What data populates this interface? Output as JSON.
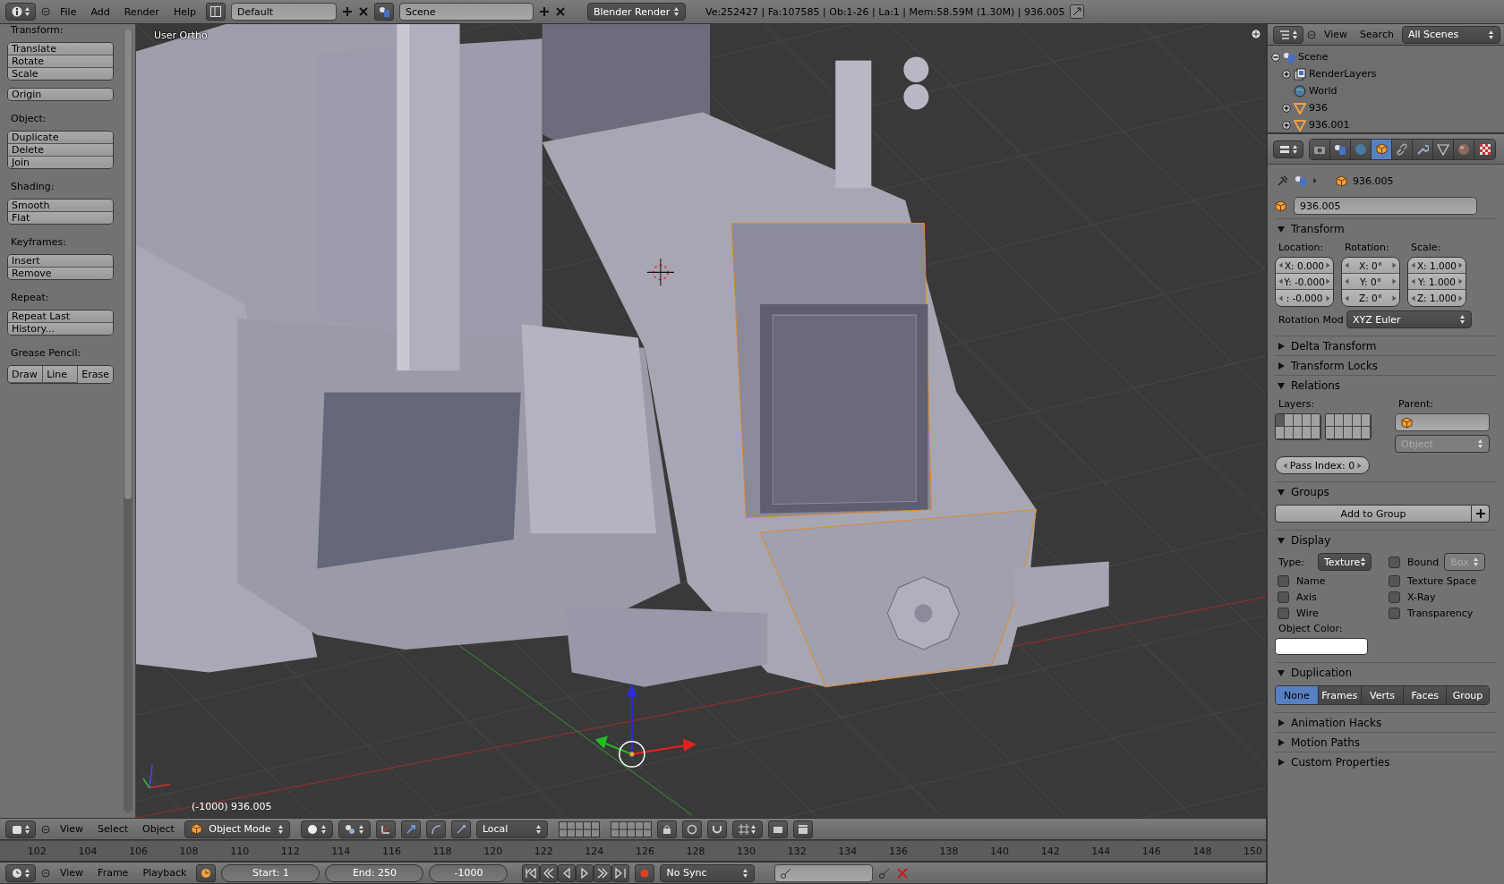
{
  "top_bar": {
    "menus": [
      "File",
      "Add",
      "Render",
      "Help"
    ],
    "layout": "Default",
    "scene": "Scene",
    "engine": "Blender Render",
    "stats": "Ve:252427 | Fa:107585 | Ob:1-26 | La:1 | Mem:58.59M (1.30M) | 936.005"
  },
  "tool_shelf": {
    "sections": [
      {
        "title": "Transform:",
        "kind": "column",
        "buttons": [
          "Translate",
          "Rotate",
          "Scale"
        ]
      },
      {
        "kind": "column",
        "buttons": [
          "Origin"
        ]
      },
      {
        "title": "Object:",
        "kind": "column",
        "buttons": [
          "Duplicate",
          "Delete",
          "Join"
        ]
      },
      {
        "title": "Shading:",
        "kind": "column",
        "buttons": [
          "Smooth",
          "Flat"
        ]
      },
      {
        "title": "Keyframes:",
        "kind": "column",
        "buttons": [
          "Insert",
          "Remove"
        ]
      },
      {
        "title": "Repeat:",
        "kind": "column",
        "buttons": [
          "Repeat Last",
          "History..."
        ]
      },
      {
        "title": "Grease Pencil:",
        "kind": "row",
        "buttons": [
          "Draw",
          "Line",
          "Erase"
        ]
      }
    ]
  },
  "viewport": {
    "view_label": "User Ortho",
    "object_label": "(-1000) 936.005"
  },
  "view_header": {
    "menus": [
      "View",
      "Select",
      "Object"
    ],
    "mode": "Object Mode",
    "orientation": "Local"
  },
  "timeline": {
    "ticks": [
      "102",
      "104",
      "106",
      "108",
      "110",
      "112",
      "114",
      "116",
      "118",
      "120",
      "122",
      "124",
      "126",
      "128",
      "130",
      "132",
      "134",
      "136",
      "138",
      "140",
      "142",
      "144",
      "146",
      "148",
      "150"
    ]
  },
  "timeline_header": {
    "menus": [
      "View",
      "Frame",
      "Playback"
    ],
    "start": "Start: 1",
    "end": "End: 250",
    "current": "-1000",
    "sync": "No Sync"
  },
  "outliner": {
    "menus": [
      "View",
      "Search"
    ],
    "filter": "All Scenes",
    "tree": [
      {
        "label": "Scene",
        "kind": "scene",
        "expanded": true,
        "children": [
          {
            "label": "RenderLayers",
            "kind": "layers",
            "expanded": false
          },
          {
            "label": "World",
            "kind": "world"
          },
          {
            "label": "936",
            "kind": "mesh",
            "expanded": false
          },
          {
            "label": "936.001",
            "kind": "mesh",
            "expanded": false
          }
        ]
      }
    ]
  },
  "properties": {
    "tabs": [
      {
        "kind": "render",
        "selected": false
      },
      {
        "kind": "scene",
        "selected": false
      },
      {
        "kind": "world",
        "selected": false
      },
      {
        "kind": "object",
        "selected": true
      },
      {
        "kind": "constraints",
        "selected": false
      },
      {
        "kind": "modifiers",
        "selected": false
      },
      {
        "kind": "data",
        "selected": false
      },
      {
        "kind": "material",
        "selected": false
      },
      {
        "kind": "texture",
        "selected": false
      }
    ],
    "breadcrumb": "936.005",
    "name": "936.005",
    "panels": [
      {
        "title": "Transform",
        "expanded": true,
        "kind": "transform",
        "columns": [
          {
            "label": "Location:",
            "fields": [
              "X: 0.000",
              "Y: -0.000",
              ": -0.000"
            ]
          },
          {
            "label": "Rotation:",
            "fields": [
              "X: 0°",
              "Y: 0°",
              "Z: 0°"
            ]
          },
          {
            "label": "Scale:",
            "fields": [
              "X: 1.000",
              "Y: 1.000",
              "Z: 1.000"
            ]
          }
        ],
        "mode_label": "Rotation Mod",
        "mode": "XYZ Euler"
      },
      {
        "title": "Delta Transform",
        "expanded": false
      },
      {
        "title": "Transform Locks",
        "expanded": false
      },
      {
        "title": "Relations",
        "expanded": true,
        "kind": "relations",
        "layers_label": "Layers:",
        "layers": [
          {
            "on": true
          },
          {
            "on": false
          },
          {
            "on": false
          },
          {
            "on": false
          },
          {
            "on": false
          },
          {
            "on": false
          },
          {
            "on": false
          },
          {
            "on": false
          },
          {
            "on": false
          },
          {
            "on": false
          },
          {
            "on": false
          },
          {
            "on": false
          },
          {
            "on": false
          },
          {
            "on": false
          },
          {
            "on": false
          },
          {
            "on": false
          },
          {
            "on": false
          },
          {
            "on": false
          },
          {
            "on": false
          },
          {
            "on": false
          }
        ],
        "parent_label": "Parent:",
        "parent_type": "Object",
        "pass_index": "Pass Index: 0"
      },
      {
        "title": "Groups",
        "expanded": true,
        "kind": "groups",
        "button": "Add to Group"
      },
      {
        "title": "Display",
        "expanded": true,
        "kind": "display",
        "type_label": "Type:",
        "type": "Texture",
        "bound": {
          "label": "Bound",
          "checked": false
        },
        "bound_type": "Box",
        "options": [
          {
            "label": "Name",
            "checked": false
          },
          {
            "label": "Texture Space",
            "checked": false
          },
          {
            "label": "Axis",
            "checked": false
          },
          {
            "label": "X-Ray",
            "checked": false
          },
          {
            "label": "Wire",
            "checked": false
          },
          {
            "label": "Transparency",
            "checked": false
          }
        ],
        "color_label": "Object Color:"
      },
      {
        "title": "Duplication",
        "expanded": true,
        "kind": "duplication",
        "options": [
          {
            "label": "None",
            "selected": true
          },
          {
            "label": "Frames",
            "selected": false
          },
          {
            "label": "Verts",
            "selected": false
          },
          {
            "label": "Faces",
            "selected": false
          },
          {
            "label": "Group",
            "selected": false
          }
        ]
      },
      {
        "title": "Animation Hacks",
        "expanded": false
      },
      {
        "title": "Motion Paths",
        "expanded": false
      },
      {
        "title": "Custom Properties",
        "expanded": false
      }
    ]
  }
}
